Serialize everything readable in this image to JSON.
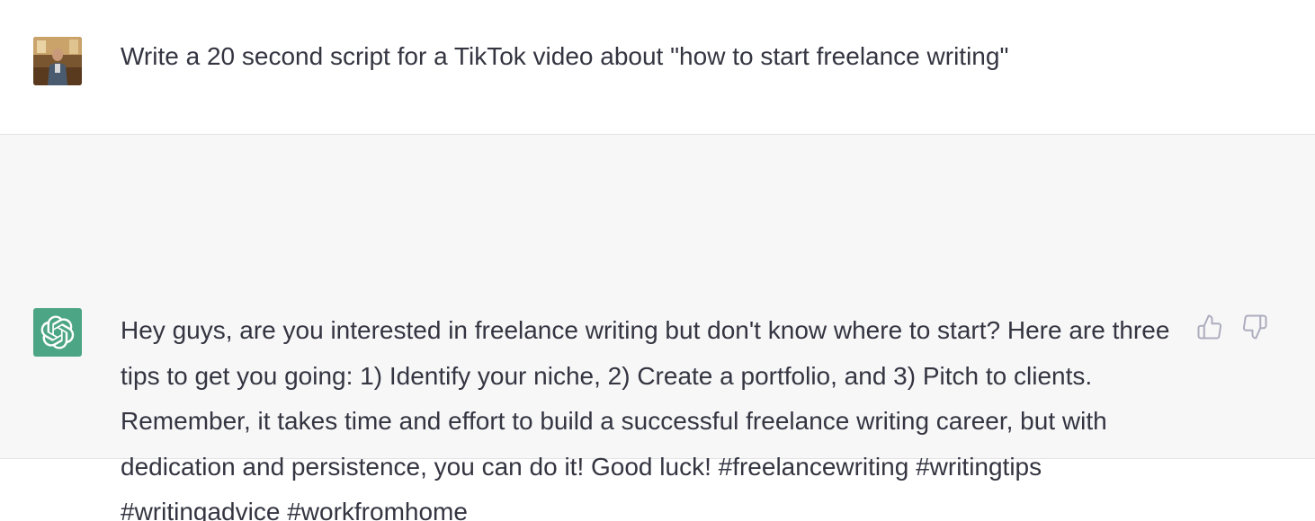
{
  "conversation": {
    "user_message": {
      "avatar_icon": "user-photo-avatar",
      "text": "Write a 20 second script for a TikTok video about \"how to start freelance writing\""
    },
    "assistant_message": {
      "avatar_icon": "openai-logo-icon",
      "text": "Hey guys, are you interested in freelance writing but don't know where to start? Here are three tips to get you going: 1) Identify your niche, 2) Create a portfolio, and 3) Pitch to clients. Remember, it takes time and effort to build a successful freelance writing career, but with dedication and persistence, you can do it! Good luck! #freelancewriting #writingtips #writingadvice #workfromhome",
      "feedback": {
        "thumbs_up_icon": "thumbs-up-icon",
        "thumbs_down_icon": "thumbs-down-icon"
      }
    }
  },
  "colors": {
    "assistant_background": "#f7f7f8",
    "brand_green": "#4ca585",
    "text": "#343541",
    "icon_gray": "#acacbe"
  }
}
